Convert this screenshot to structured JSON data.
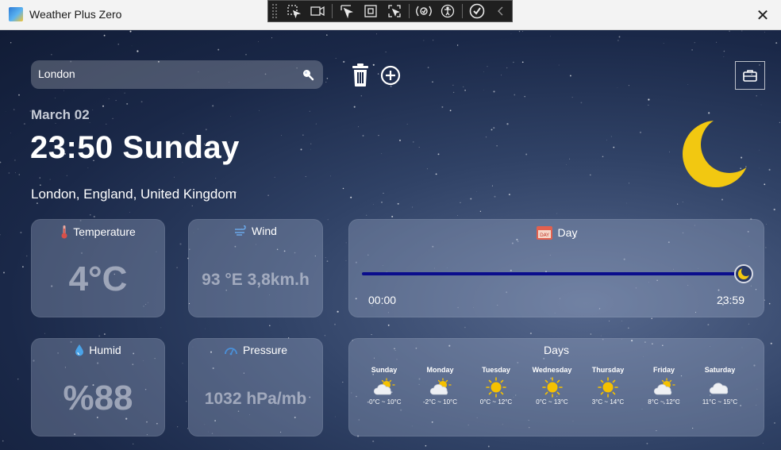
{
  "window": {
    "title": "Weather Plus Zero",
    "close_glyph": "✕"
  },
  "devtools": {
    "tools": [
      "select-element-icon",
      "record-icon",
      "pointer-icon",
      "frame-icon",
      "track-focus-icon",
      "layout-adorner-icon",
      "accessibility-icon",
      "check-icon",
      "collapse-chevron-icon"
    ]
  },
  "search": {
    "value": "London"
  },
  "header": {
    "date": "March 02",
    "time_day": "23:50 Sunday",
    "location": "London, England, United Kingdom"
  },
  "cards": {
    "temperature": {
      "label": "Temperature",
      "value": "4°C"
    },
    "wind": {
      "label": "Wind",
      "value": "93 °E 3,8km.h"
    },
    "humid": {
      "label": "Humid",
      "value": "%88"
    },
    "pressure": {
      "label": "Pressure",
      "value": "1032 hPa/mb"
    }
  },
  "day_panel": {
    "label": "Day",
    "icon_text": "DAY",
    "start": "00:00",
    "end": "23:59",
    "progress": 0.99
  },
  "days_panel": {
    "label": "Days",
    "days": [
      {
        "name": "Sunday",
        "icon": "partly-cloudy-icon",
        "range": "-0°C ~ 10°C"
      },
      {
        "name": "Monday",
        "icon": "partly-cloudy-icon",
        "range": "-2°C ~ 10°C"
      },
      {
        "name": "Tuesday",
        "icon": "sun-icon",
        "range": "0°C ~ 12°C"
      },
      {
        "name": "Wednesday",
        "icon": "sun-icon",
        "range": "0°C ~ 13°C"
      },
      {
        "name": "Thursday",
        "icon": "sun-icon",
        "range": "3°C ~ 14°C"
      },
      {
        "name": "Friday",
        "icon": "partly-cloudy-icon",
        "range": "8°C ~ 12°C"
      },
      {
        "name": "Saturday",
        "icon": "cloud-icon",
        "range": "11°C ~ 15°C"
      }
    ]
  },
  "colors": {
    "accent": "#0a0d8c",
    "moon": "#f2c811",
    "sun": "#f6c100"
  }
}
